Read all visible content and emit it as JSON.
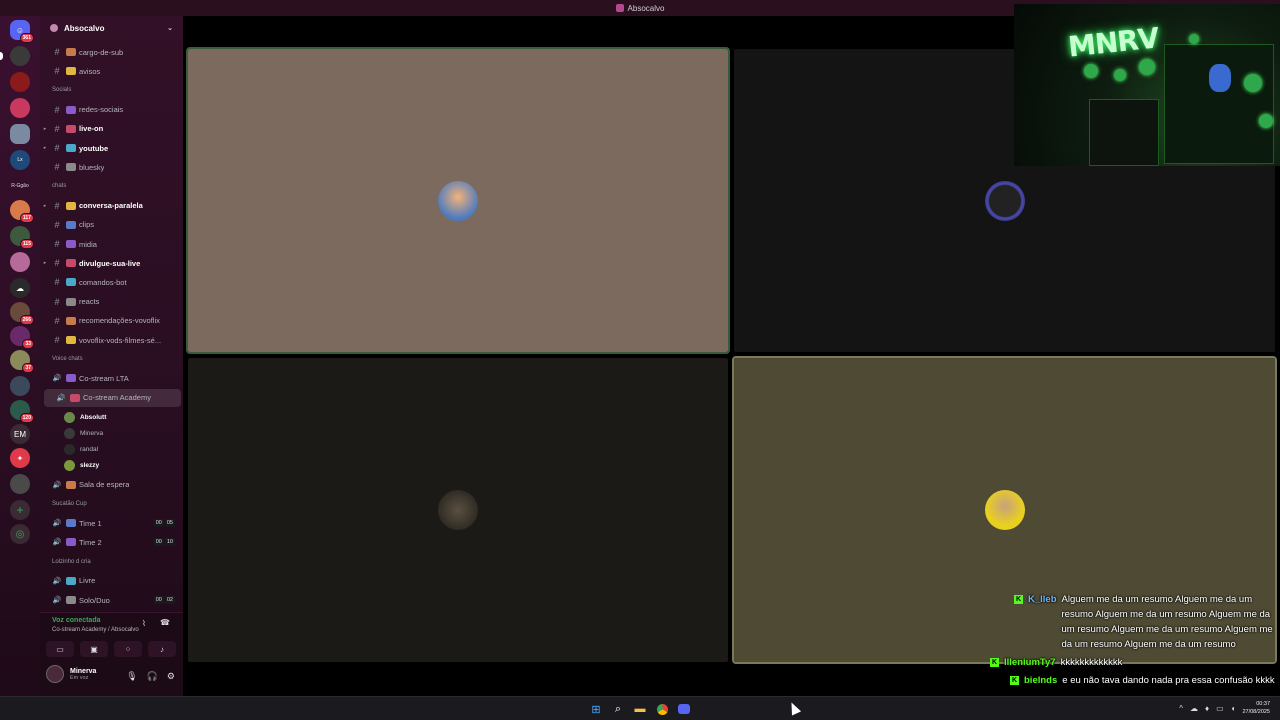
{
  "window": {
    "title": "Absocalvo"
  },
  "server": {
    "name": "Absocalvo"
  },
  "rail": {
    "badges": [
      "361",
      "117",
      "115",
      "266",
      "33",
      "37",
      "120"
    ],
    "em_label": "EM",
    "gif_label": "R-Ggão"
  },
  "channels": [
    {
      "label": "cargo-de-sub",
      "emoji": "📜"
    },
    {
      "label": "avisos",
      "emoji": "🔔"
    },
    {
      "category": "Socials"
    },
    {
      "label": "redes-sociais"
    },
    {
      "label": "live-on",
      "bold": true
    },
    {
      "label": "youtube",
      "bold": true
    },
    {
      "label": "bluesky"
    },
    {
      "category": "chats"
    },
    {
      "label": "conversa-paralela",
      "bold": true
    },
    {
      "label": "clips"
    },
    {
      "label": "midia"
    },
    {
      "label": "divulgue-sua-live",
      "bold": true
    },
    {
      "label": "comandos-bot"
    },
    {
      "label": "reacts"
    },
    {
      "label": "recomendações-vovoflix"
    },
    {
      "label": "vovoflix-vods-filmes-sé..."
    },
    {
      "category": "Voice chats"
    },
    {
      "label": "Co-stream LTA"
    },
    {
      "label": "Co-stream Academy",
      "active": true
    }
  ],
  "voice_users": [
    {
      "name": "Absolutt",
      "bold": true
    },
    {
      "name": "Minerva"
    },
    {
      "name": "randal"
    },
    {
      "name": "slezzy",
      "bold": true
    }
  ],
  "channels_lower": [
    {
      "label": "Sala de espera"
    },
    {
      "category": "Sucatão Cup"
    },
    {
      "label": "Time 1",
      "count_a": "00",
      "count_b": "05"
    },
    {
      "label": "Time 2",
      "count_a": "00",
      "count_b": "10"
    },
    {
      "category": "Lolzinho d cria"
    },
    {
      "label": "Livre"
    },
    {
      "label": "Solo/Duo",
      "count_a": "00",
      "count_b": "02"
    }
  ],
  "voice_panel": {
    "status": "Voz conectada",
    "location": "Co-stream Academy / Absocalvo"
  },
  "user_panel": {
    "name": "Minerva",
    "status": "Em voz"
  },
  "webcam": {
    "logo_text": "MNRV"
  },
  "chat": [
    {
      "user": "K_lleb",
      "color": "#6cb4ff",
      "text": "Alguem me da um resumo Alguem me da um resumo Alguem me da um resumo Alguem me da um resumo Alguem me da um resumo Alguem me da um resumo Alguem me da um resumo"
    },
    {
      "user": "IlleniumTy7",
      "color": "#53fc18",
      "text": "kkkkkkkkkkkkk"
    },
    {
      "user": "bielnds",
      "color": "#53fc18",
      "text": "e eu não tava dando nada pra essa confusão kkkk"
    }
  ],
  "taskbar": {
    "time": "00:37",
    "date": "27/08/2025"
  },
  "colors": {
    "accent": "#53fc18",
    "speaking": "#3ba55c"
  }
}
